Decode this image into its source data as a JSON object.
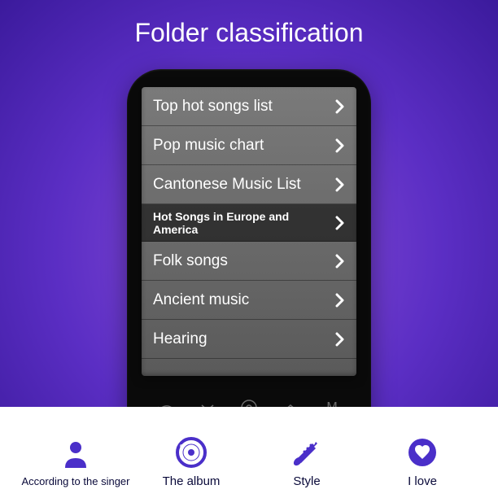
{
  "title": "Folder classification",
  "colors": {
    "accent": "#4a2fc9",
    "text_white": "#ffffff"
  },
  "list": {
    "items": [
      {
        "label": "Top hot songs list",
        "highlighted": false
      },
      {
        "label": "Pop music chart",
        "highlighted": false
      },
      {
        "label": "Cantonese Music List",
        "highlighted": false
      },
      {
        "label": "Hot Songs in Europe and America",
        "highlighted": true
      },
      {
        "label": "Folk songs",
        "highlighted": false
      },
      {
        "label": "Ancient music",
        "highlighted": false
      },
      {
        "label": "Hearing",
        "highlighted": false
      }
    ]
  },
  "hardware_buttons": {
    "back": "↶",
    "down": "⌄",
    "cd": "◎",
    "up": "⌃",
    "menu": "M"
  },
  "tabs": {
    "items": [
      {
        "label": "According to the singer",
        "icon": "person-icon",
        "small": true
      },
      {
        "label": "The album",
        "icon": "album-icon",
        "small": false
      },
      {
        "label": "Style",
        "icon": "trumpet-icon",
        "small": false
      },
      {
        "label": "I love",
        "icon": "heart-icon",
        "small": false
      }
    ]
  }
}
